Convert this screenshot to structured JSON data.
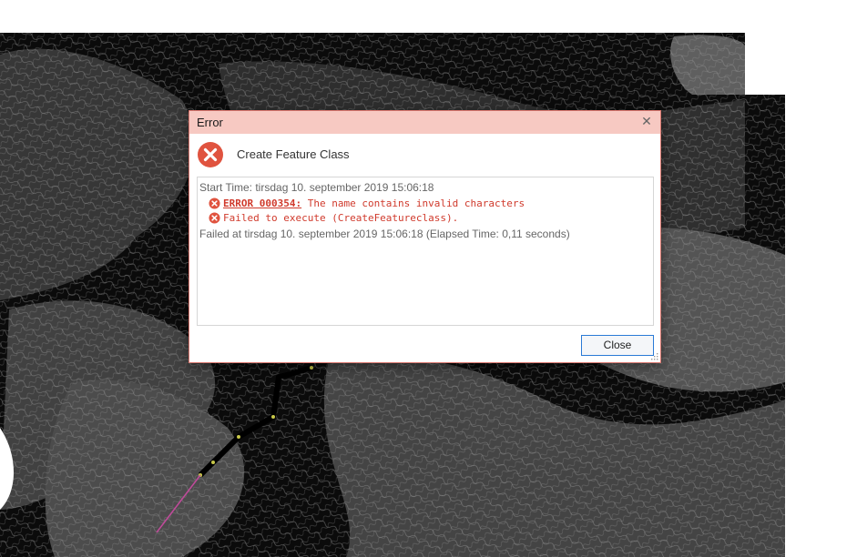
{
  "dialog": {
    "title": "Error",
    "close_glyph": "✕",
    "tool_name": "Create Feature Class",
    "header_icon": "error-circle-icon",
    "close_button_label": "Close"
  },
  "messages": {
    "start": "Start Time: tirsdag 10. september 2019 15:06:18",
    "errors": [
      {
        "code": "ERROR 000354:",
        "text": " The name contains invalid characters"
      },
      {
        "code": "",
        "text": "Failed to execute (CreateFeatureclass)."
      }
    ],
    "end": "Failed at tirsdag 10. september 2019 15:06:18 (Elapsed Time: 0,11 seconds)"
  },
  "colors": {
    "titlebar": "#f7c9c2",
    "error_red": "#d03a2c",
    "dialog_border": "#d9766e",
    "button_border": "#2a7ad6"
  }
}
